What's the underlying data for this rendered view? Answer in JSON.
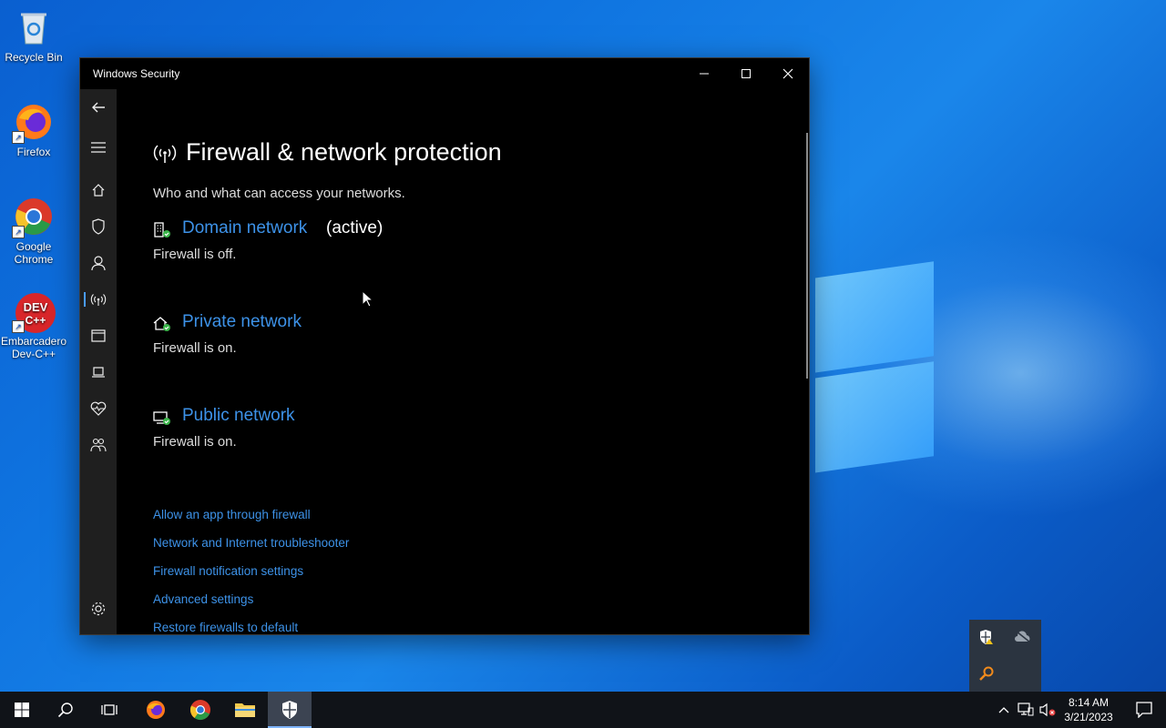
{
  "desktop": {
    "icons": [
      {
        "label": "Recycle Bin"
      },
      {
        "label": "Firefox"
      },
      {
        "label": "Google Chrome"
      },
      {
        "label": "Embarcadero Dev-C++"
      }
    ]
  },
  "window": {
    "title": "Windows Security",
    "controls": {
      "minimize": "—",
      "maximize": "☐",
      "close": "✕"
    }
  },
  "page": {
    "title": "Firewall & network protection",
    "subtitle": "Who and what can access your networks.",
    "networks": [
      {
        "name": "Domain network",
        "badge": "(active)",
        "status": "Firewall is off."
      },
      {
        "name": "Private network",
        "badge": "",
        "status": "Firewall is on."
      },
      {
        "name": "Public network",
        "badge": "",
        "status": "Firewall is on."
      }
    ],
    "links": [
      "Allow an app through firewall",
      "Network and Internet troubleshooter",
      "Firewall notification settings",
      "Advanced settings",
      "Restore firewalls to default"
    ]
  },
  "sidebar": {
    "items": [
      "back-icon",
      "menu-icon",
      "home-icon",
      "shield-icon",
      "account-icon",
      "firewall-icon",
      "app-browser-icon",
      "device-icon",
      "health-icon",
      "family-icon",
      "settings-icon"
    ],
    "active": "firewall-icon"
  },
  "taskbar": {
    "time": "8:14 AM",
    "date": "3/21/2023"
  },
  "colors": {
    "accent": "#3d92e8",
    "window_bg": "#000000",
    "sidebar_bg": "#1f1f1f",
    "taskbar_bg": "#101318"
  }
}
